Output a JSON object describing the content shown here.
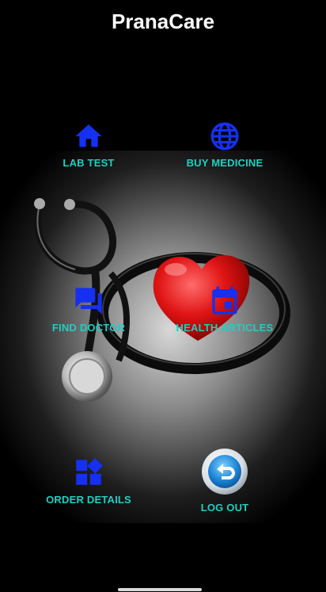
{
  "app": {
    "title": "PranaCare"
  },
  "menu": {
    "lab_test": {
      "label": "LAB TEST",
      "icon": "home-icon"
    },
    "buy_medicine": {
      "label": "BUY MEDICINE",
      "icon": "globe-icon"
    },
    "find_doctor": {
      "label": "FIND DOCTOR",
      "icon": "chat-icon"
    },
    "health_articles": {
      "label": "HEALTH ARTICLES",
      "icon": "calendar-icon"
    },
    "order_details": {
      "label": "ORDER DETAILS",
      "icon": "widgets-icon"
    },
    "log_out": {
      "label": "LOG OUT",
      "icon": "logout-icon"
    }
  },
  "colors": {
    "icon": "#1530f0",
    "label": "#1fcfc2",
    "background": "#000000",
    "title": "#ffffff"
  }
}
